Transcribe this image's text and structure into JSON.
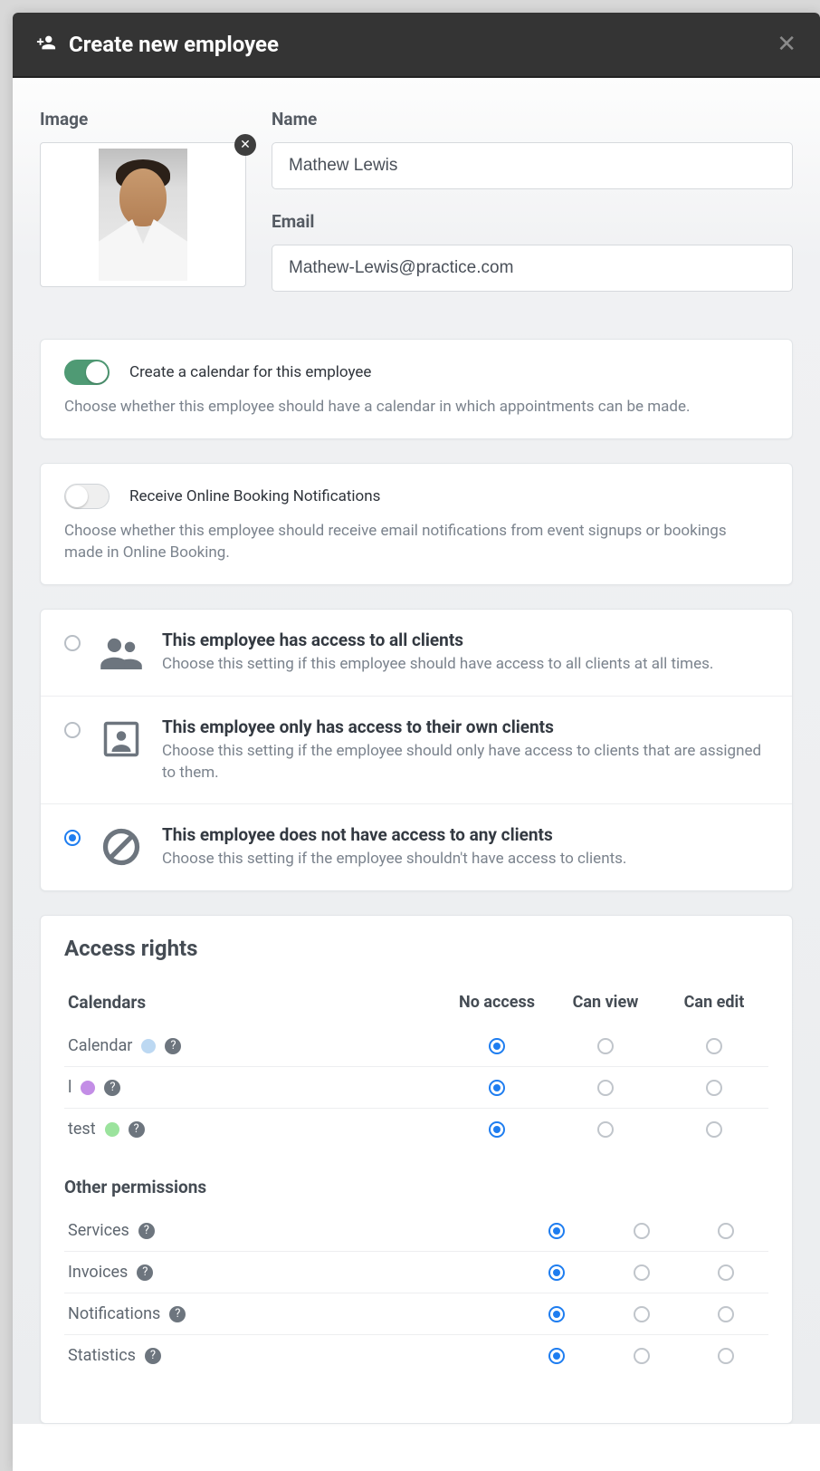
{
  "modal": {
    "title": "Create new employee",
    "image_label": "Image",
    "name_label": "Name",
    "email_label": "Email",
    "name_value": "Mathew Lewis",
    "email_value": "Mathew-Lewis@practice.com"
  },
  "toggles": {
    "calendar": {
      "label": "Create a calendar for this employee",
      "help": "Choose whether this employee should have a calendar in which appointments can be made.",
      "value": true
    },
    "notifications": {
      "label": "Receive Online Booking Notifications",
      "help": "Choose whether this employee should receive email notifications from event signups or bookings made in Online Booking.",
      "value": false
    }
  },
  "client_access": {
    "options": [
      {
        "title": "This employee has access to all clients",
        "desc": "Choose this setting if this employee should have access to all clients at all times.",
        "selected": false
      },
      {
        "title": "This employee only has access to their own clients",
        "desc": "Choose this setting if the employee should only have access to clients that are assigned to them.",
        "selected": false
      },
      {
        "title": "This employee does not have access to any clients",
        "desc": "Choose this setting if the employee shouldn't have access to clients.",
        "selected": true
      }
    ]
  },
  "access_rights": {
    "title": "Access rights",
    "columns": {
      "c1": "No access",
      "c2": "Can view",
      "c3": "Can edit"
    },
    "calendars_label": "Calendars",
    "calendars": [
      {
        "name": "Calendar",
        "color": "#bcd8f2",
        "value": "no"
      },
      {
        "name": "l",
        "color": "#c38de6",
        "value": "no"
      },
      {
        "name": "test",
        "color": "#9be39d",
        "value": "no"
      }
    ],
    "other_label": "Other permissions",
    "others": [
      {
        "name": "Services",
        "value": "no"
      },
      {
        "name": "Invoices",
        "value": "no"
      },
      {
        "name": "Notifications",
        "value": "no"
      },
      {
        "name": "Statistics",
        "value": "no"
      }
    ]
  }
}
